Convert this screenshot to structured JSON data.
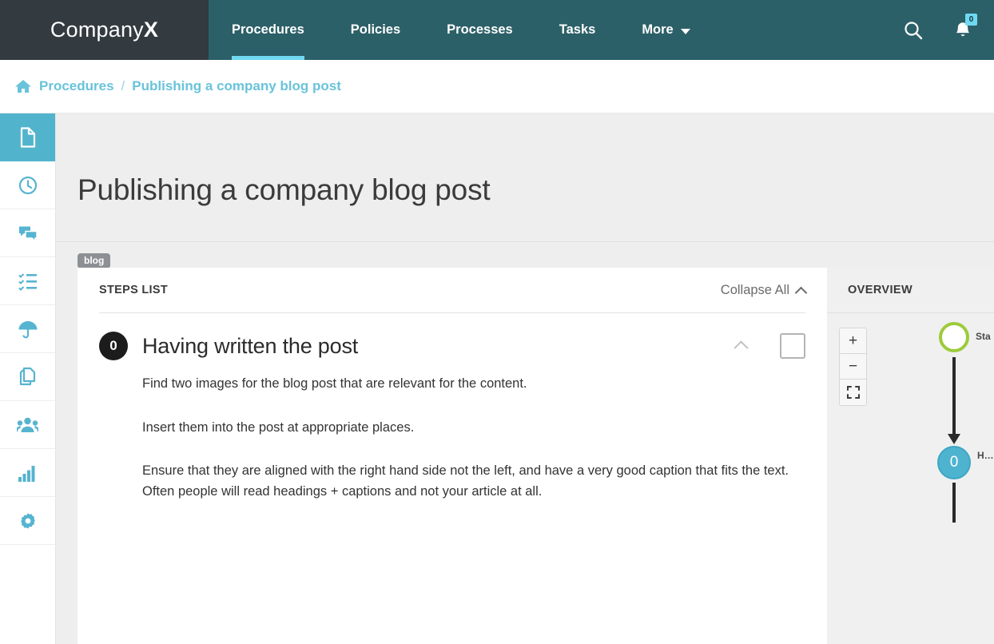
{
  "header": {
    "brand_light": "Company",
    "brand_bold": "X",
    "nav": [
      {
        "label": "Procedures",
        "active": true
      },
      {
        "label": "Policies",
        "active": false
      },
      {
        "label": "Processes",
        "active": false
      },
      {
        "label": "Tasks",
        "active": false
      },
      {
        "label": "More",
        "active": false,
        "has_caret": true
      }
    ],
    "search_icon": "search-icon",
    "bell_icon": "bell-icon",
    "notification_count": "0",
    "colors": {
      "brand_bg": "#333a40",
      "nav_bg": "#2c6068",
      "active_underline": "#6fd9f2",
      "badge_bg": "#6fd9f2"
    }
  },
  "breadcrumb": {
    "home_icon": "home-icon",
    "root": "Procedures",
    "separator": "/",
    "current": "Publishing a company blog post",
    "link_color": "#69c3da"
  },
  "sidebar": {
    "items": [
      {
        "icon": "document-icon",
        "name": "document",
        "active": true
      },
      {
        "icon": "clock-icon",
        "name": "history",
        "active": false
      },
      {
        "icon": "comments-icon",
        "name": "comments",
        "active": false
      },
      {
        "icon": "checklist-icon",
        "name": "tasks",
        "active": false
      },
      {
        "icon": "umbrella-icon",
        "name": "risk",
        "active": false
      },
      {
        "icon": "copy-icon",
        "name": "duplicate",
        "active": false
      },
      {
        "icon": "users-icon",
        "name": "people",
        "active": false
      },
      {
        "icon": "bar-chart-icon",
        "name": "statistics",
        "active": false
      },
      {
        "icon": "gear-icon",
        "name": "settings",
        "active": false
      }
    ],
    "active_bg": "#52b4cc",
    "icon_color": "#56b4d0"
  },
  "main": {
    "page_title": "Publishing a company blog post",
    "tags": [
      "blog"
    ],
    "tag_bg": "#8c9094"
  },
  "steps": {
    "section_label": "STEPS LIST",
    "collapse_all_label": "Collapse All",
    "collapse_icon": "chevron-up-icon",
    "list": [
      {
        "number": "0",
        "title": "Having written the post",
        "collapse_icon": "chevron-up-icon",
        "checkbox_icon": "checkbox-unchecked-icon",
        "paragraphs": [
          "Find two images for the blog post that are relevant for the content.",
          "Insert them into the post at appropriate places.",
          "Ensure that they are aligned with the right hand side not the left, and have a very good caption that fits the text. Often people will read headings + captions and not your article at all."
        ]
      }
    ]
  },
  "overview": {
    "section_label": "OVERVIEW",
    "zoom_in_label": "+",
    "zoom_out_label": "−",
    "fit_icon": "fit-screen-icon",
    "flow": {
      "start_node_label": "Sta",
      "start_node_color": "#9ccb3b",
      "step_node_number": "0",
      "step_node_label": "H… p…",
      "step_node_color": "#4eb3cf"
    }
  }
}
